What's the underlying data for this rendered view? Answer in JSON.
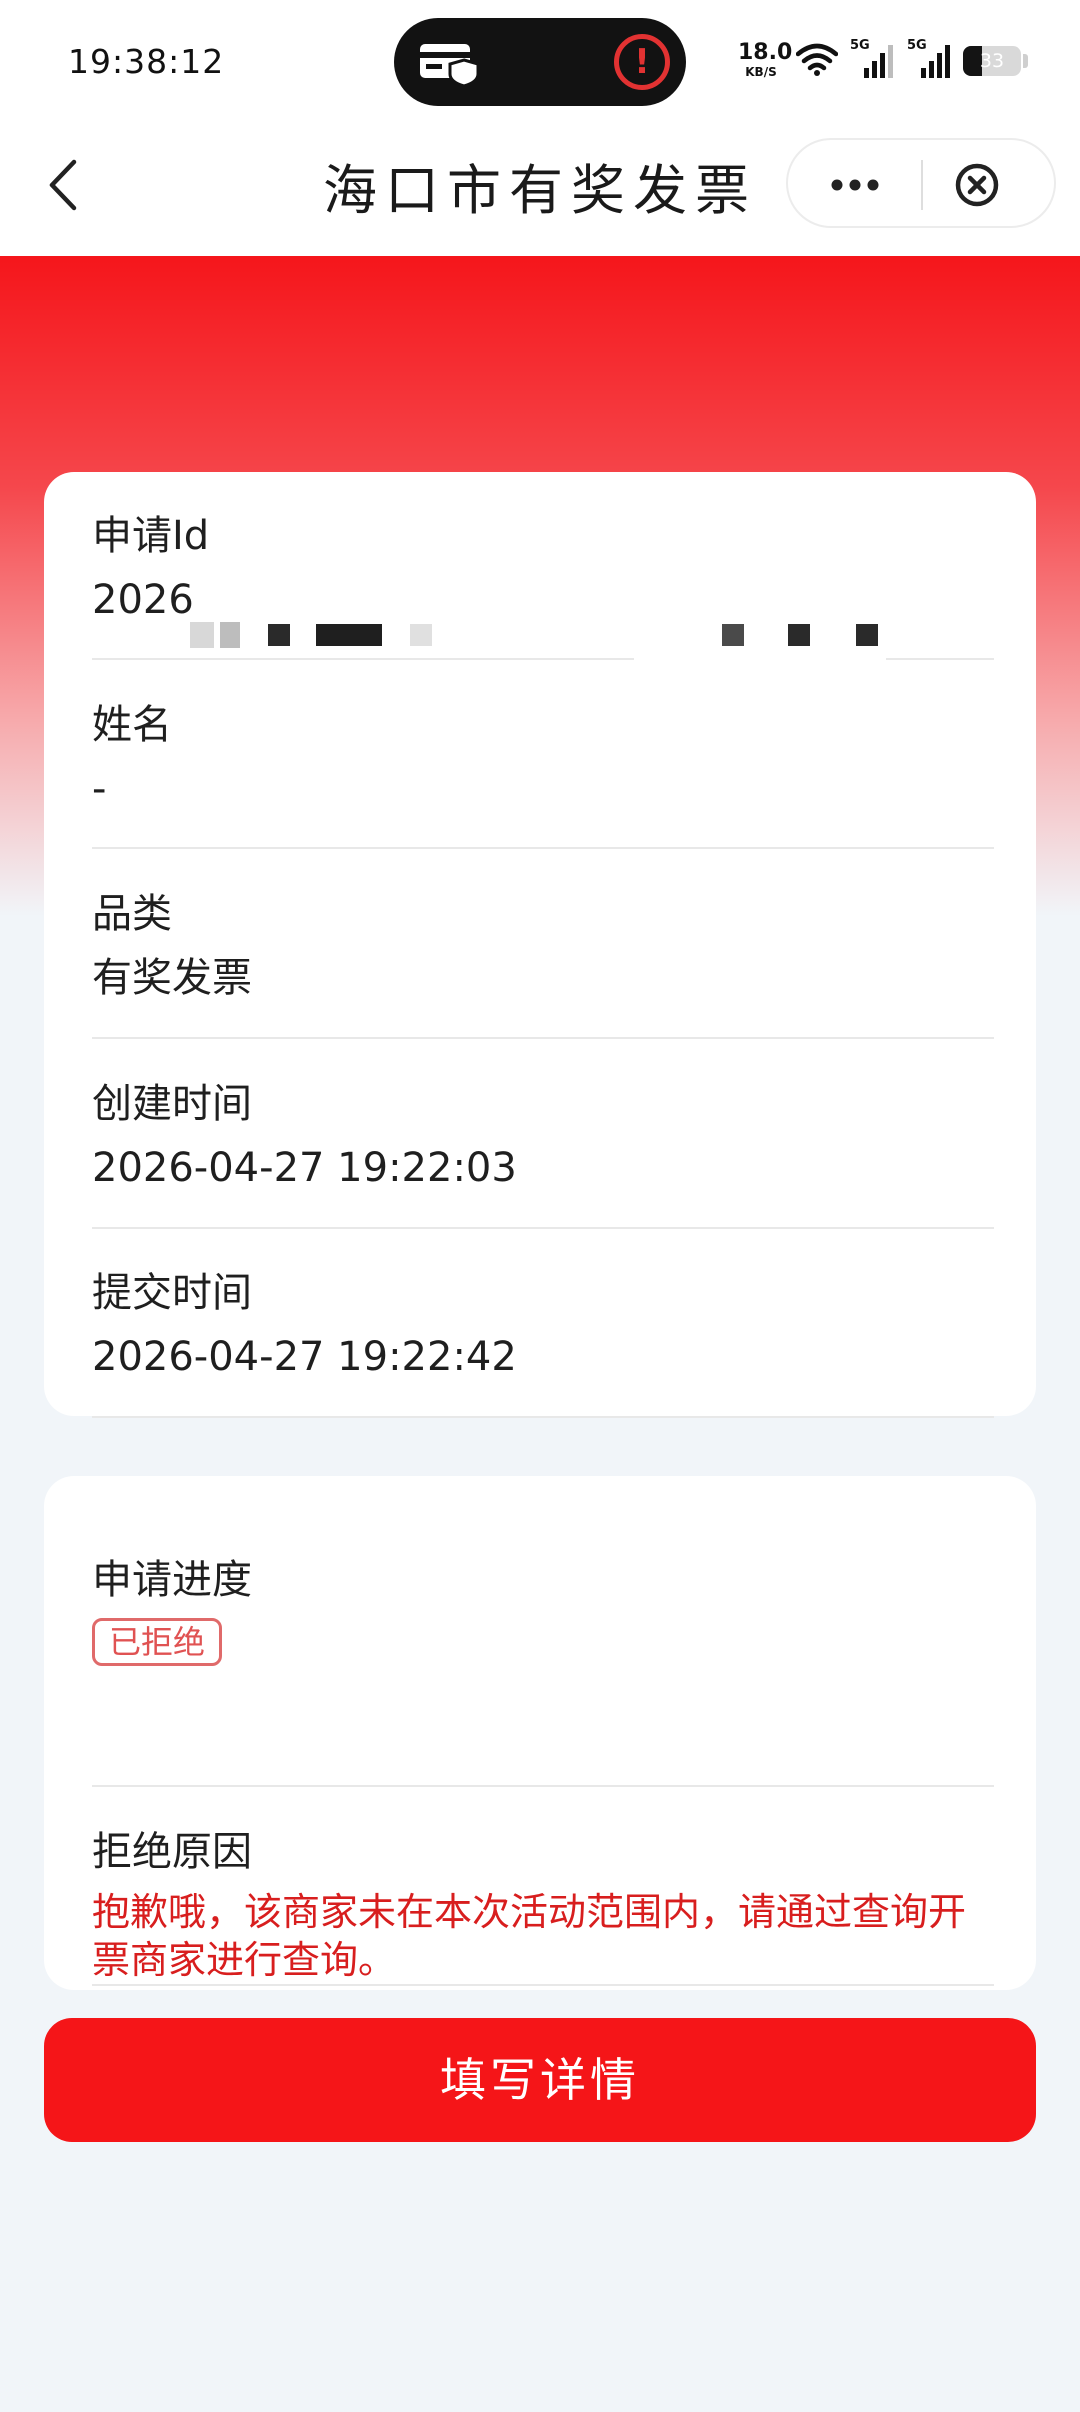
{
  "status_bar": {
    "time": "19:38:12",
    "net_speed": "18.0",
    "net_unit": "KB/S",
    "signal_1_label": "5G",
    "signal_2_label": "5G",
    "battery": "33",
    "battery_level": 0.33
  },
  "nav": {
    "title": "海口市有奖发票"
  },
  "info_card": {
    "apply_id_label": "申请Id",
    "apply_id_value": "2026",
    "name_label": "姓名",
    "name_value": "-",
    "category_label": "品类",
    "category_value": "有奖发票",
    "created_label": "创建时间",
    "created_value": "2026-04-27 19:22:03",
    "submitted_label": "提交时间",
    "submitted_value": "2026-04-27 19:22:42"
  },
  "progress_card": {
    "progress_label": "申请进度",
    "status_badge": "已拒绝",
    "reason_label": "拒绝原因",
    "reason_text": "抱歉哦，该商家未在本次活动范围内，请通过查询开票商家进行查询。"
  },
  "actions": {
    "fill_details": "填写详情"
  },
  "colors": {
    "brand_red": "#f51518",
    "reason_red": "#d81e1e",
    "badge_border": "#e06a6a",
    "page_bg": "#f1f5f9"
  }
}
